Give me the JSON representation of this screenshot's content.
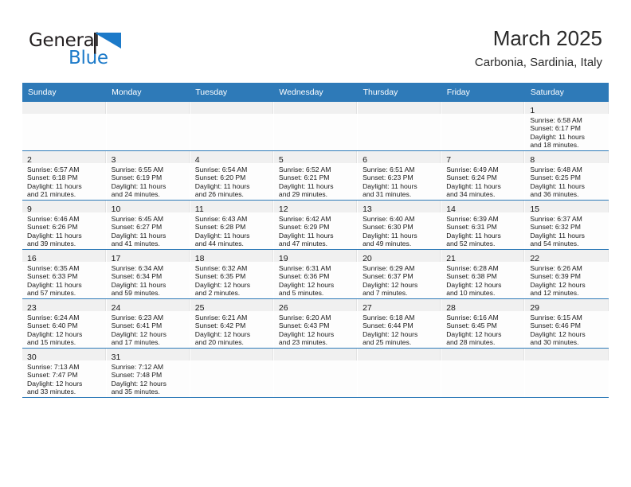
{
  "brand": {
    "name_part1": "General",
    "name_part2": "Blue",
    "flag_color": "#1c7ac9"
  },
  "header": {
    "title": "March 2025",
    "subtitle": "Carbonia, Sardinia, Italy"
  },
  "theme": {
    "header_blue": "#2e7ab8",
    "row_border_blue": "#2e7ab8",
    "daynum_band": "#f0f0f0"
  },
  "weekdays": [
    "Sunday",
    "Monday",
    "Tuesday",
    "Wednesday",
    "Thursday",
    "Friday",
    "Saturday"
  ],
  "weeks": [
    [
      {
        "empty": true
      },
      {
        "empty": true
      },
      {
        "empty": true
      },
      {
        "empty": true
      },
      {
        "empty": true
      },
      {
        "empty": true
      },
      {
        "day": "1",
        "sunrise": "Sunrise: 6:58 AM",
        "sunset": "Sunset: 6:17 PM",
        "daylight_line1": "Daylight: 11 hours",
        "daylight_line2": "and 18 minutes."
      }
    ],
    [
      {
        "day": "2",
        "sunrise": "Sunrise: 6:57 AM",
        "sunset": "Sunset: 6:18 PM",
        "daylight_line1": "Daylight: 11 hours",
        "daylight_line2": "and 21 minutes."
      },
      {
        "day": "3",
        "sunrise": "Sunrise: 6:55 AM",
        "sunset": "Sunset: 6:19 PM",
        "daylight_line1": "Daylight: 11 hours",
        "daylight_line2": "and 24 minutes."
      },
      {
        "day": "4",
        "sunrise": "Sunrise: 6:54 AM",
        "sunset": "Sunset: 6:20 PM",
        "daylight_line1": "Daylight: 11 hours",
        "daylight_line2": "and 26 minutes."
      },
      {
        "day": "5",
        "sunrise": "Sunrise: 6:52 AM",
        "sunset": "Sunset: 6:21 PM",
        "daylight_line1": "Daylight: 11 hours",
        "daylight_line2": "and 29 minutes."
      },
      {
        "day": "6",
        "sunrise": "Sunrise: 6:51 AM",
        "sunset": "Sunset: 6:23 PM",
        "daylight_line1": "Daylight: 11 hours",
        "daylight_line2": "and 31 minutes."
      },
      {
        "day": "7",
        "sunrise": "Sunrise: 6:49 AM",
        "sunset": "Sunset: 6:24 PM",
        "daylight_line1": "Daylight: 11 hours",
        "daylight_line2": "and 34 minutes."
      },
      {
        "day": "8",
        "sunrise": "Sunrise: 6:48 AM",
        "sunset": "Sunset: 6:25 PM",
        "daylight_line1": "Daylight: 11 hours",
        "daylight_line2": "and 36 minutes."
      }
    ],
    [
      {
        "day": "9",
        "sunrise": "Sunrise: 6:46 AM",
        "sunset": "Sunset: 6:26 PM",
        "daylight_line1": "Daylight: 11 hours",
        "daylight_line2": "and 39 minutes."
      },
      {
        "day": "10",
        "sunrise": "Sunrise: 6:45 AM",
        "sunset": "Sunset: 6:27 PM",
        "daylight_line1": "Daylight: 11 hours",
        "daylight_line2": "and 41 minutes."
      },
      {
        "day": "11",
        "sunrise": "Sunrise: 6:43 AM",
        "sunset": "Sunset: 6:28 PM",
        "daylight_line1": "Daylight: 11 hours",
        "daylight_line2": "and 44 minutes."
      },
      {
        "day": "12",
        "sunrise": "Sunrise: 6:42 AM",
        "sunset": "Sunset: 6:29 PM",
        "daylight_line1": "Daylight: 11 hours",
        "daylight_line2": "and 47 minutes."
      },
      {
        "day": "13",
        "sunrise": "Sunrise: 6:40 AM",
        "sunset": "Sunset: 6:30 PM",
        "daylight_line1": "Daylight: 11 hours",
        "daylight_line2": "and 49 minutes."
      },
      {
        "day": "14",
        "sunrise": "Sunrise: 6:39 AM",
        "sunset": "Sunset: 6:31 PM",
        "daylight_line1": "Daylight: 11 hours",
        "daylight_line2": "and 52 minutes."
      },
      {
        "day": "15",
        "sunrise": "Sunrise: 6:37 AM",
        "sunset": "Sunset: 6:32 PM",
        "daylight_line1": "Daylight: 11 hours",
        "daylight_line2": "and 54 minutes."
      }
    ],
    [
      {
        "day": "16",
        "sunrise": "Sunrise: 6:35 AM",
        "sunset": "Sunset: 6:33 PM",
        "daylight_line1": "Daylight: 11 hours",
        "daylight_line2": "and 57 minutes."
      },
      {
        "day": "17",
        "sunrise": "Sunrise: 6:34 AM",
        "sunset": "Sunset: 6:34 PM",
        "daylight_line1": "Daylight: 11 hours",
        "daylight_line2": "and 59 minutes."
      },
      {
        "day": "18",
        "sunrise": "Sunrise: 6:32 AM",
        "sunset": "Sunset: 6:35 PM",
        "daylight_line1": "Daylight: 12 hours",
        "daylight_line2": "and 2 minutes."
      },
      {
        "day": "19",
        "sunrise": "Sunrise: 6:31 AM",
        "sunset": "Sunset: 6:36 PM",
        "daylight_line1": "Daylight: 12 hours",
        "daylight_line2": "and 5 minutes."
      },
      {
        "day": "20",
        "sunrise": "Sunrise: 6:29 AM",
        "sunset": "Sunset: 6:37 PM",
        "daylight_line1": "Daylight: 12 hours",
        "daylight_line2": "and 7 minutes."
      },
      {
        "day": "21",
        "sunrise": "Sunrise: 6:28 AM",
        "sunset": "Sunset: 6:38 PM",
        "daylight_line1": "Daylight: 12 hours",
        "daylight_line2": "and 10 minutes."
      },
      {
        "day": "22",
        "sunrise": "Sunrise: 6:26 AM",
        "sunset": "Sunset: 6:39 PM",
        "daylight_line1": "Daylight: 12 hours",
        "daylight_line2": "and 12 minutes."
      }
    ],
    [
      {
        "day": "23",
        "sunrise": "Sunrise: 6:24 AM",
        "sunset": "Sunset: 6:40 PM",
        "daylight_line1": "Daylight: 12 hours",
        "daylight_line2": "and 15 minutes."
      },
      {
        "day": "24",
        "sunrise": "Sunrise: 6:23 AM",
        "sunset": "Sunset: 6:41 PM",
        "daylight_line1": "Daylight: 12 hours",
        "daylight_line2": "and 17 minutes."
      },
      {
        "day": "25",
        "sunrise": "Sunrise: 6:21 AM",
        "sunset": "Sunset: 6:42 PM",
        "daylight_line1": "Daylight: 12 hours",
        "daylight_line2": "and 20 minutes."
      },
      {
        "day": "26",
        "sunrise": "Sunrise: 6:20 AM",
        "sunset": "Sunset: 6:43 PM",
        "daylight_line1": "Daylight: 12 hours",
        "daylight_line2": "and 23 minutes."
      },
      {
        "day": "27",
        "sunrise": "Sunrise: 6:18 AM",
        "sunset": "Sunset: 6:44 PM",
        "daylight_line1": "Daylight: 12 hours",
        "daylight_line2": "and 25 minutes."
      },
      {
        "day": "28",
        "sunrise": "Sunrise: 6:16 AM",
        "sunset": "Sunset: 6:45 PM",
        "daylight_line1": "Daylight: 12 hours",
        "daylight_line2": "and 28 minutes."
      },
      {
        "day": "29",
        "sunrise": "Sunrise: 6:15 AM",
        "sunset": "Sunset: 6:46 PM",
        "daylight_line1": "Daylight: 12 hours",
        "daylight_line2": "and 30 minutes."
      }
    ],
    [
      {
        "day": "30",
        "sunrise": "Sunrise: 7:13 AM",
        "sunset": "Sunset: 7:47 PM",
        "daylight_line1": "Daylight: 12 hours",
        "daylight_line2": "and 33 minutes."
      },
      {
        "day": "31",
        "sunrise": "Sunrise: 7:12 AM",
        "sunset": "Sunset: 7:48 PM",
        "daylight_line1": "Daylight: 12 hours",
        "daylight_line2": "and 35 minutes."
      },
      {
        "empty": true
      },
      {
        "empty": true
      },
      {
        "empty": true
      },
      {
        "empty": true
      },
      {
        "empty": true
      }
    ]
  ]
}
